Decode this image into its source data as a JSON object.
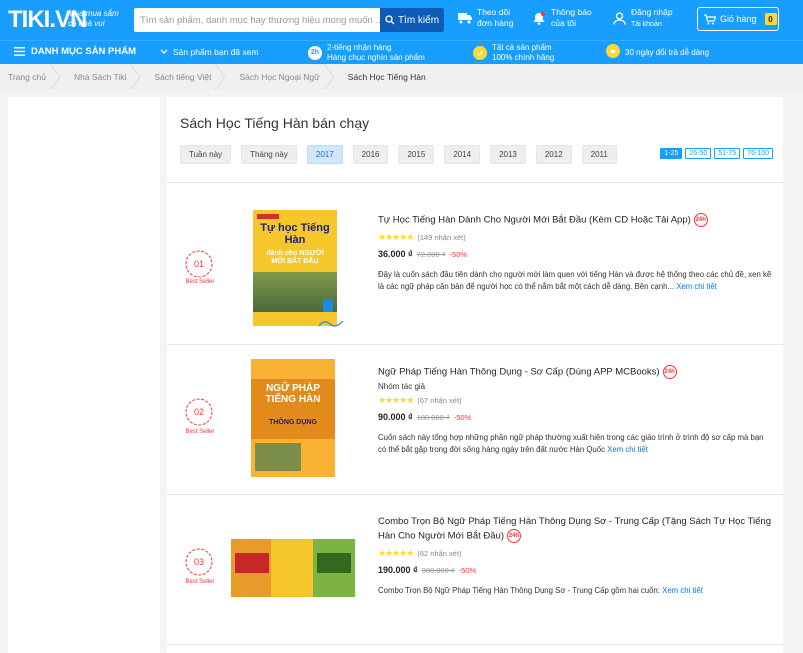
{
  "header": {
    "logo": "TIKI.VN",
    "tagline": "Mua mua sắm cả nhà vui",
    "search_placeholder": "Tìm sản phẩm, danh mục hay thương hiệu mong muốn ...",
    "search_button": "Tìm kiếm",
    "track_line1": "Theo dõi",
    "track_line2": "đơn hàng",
    "notify_line1": "Thông báo",
    "notify_line2": "của tôi",
    "login_line1": "Đăng nhập",
    "login_line2": "Tài khoản",
    "cart_label": "Giỏ hàng",
    "cart_count": "0"
  },
  "nav": {
    "menu_label": "DANH MỤC SẢN PHẨM",
    "viewed_label": "Sản phẩm bạn đã xem",
    "promo1_icon": "2h",
    "promo1_line1": "2-tiếng nhận hàng",
    "promo1_line2": "Hàng chục nghìn sản phẩm",
    "promo2_line1": "Tất cả sản phẩm",
    "promo2_line2": "100% chính hãng",
    "promo3_label": "30 ngày đổi trả dễ dàng"
  },
  "breadcrumb": [
    "Trang chủ",
    "Nhà Sách Tiki",
    "Sách tiếng Việt",
    "Sách Học Ngoại Ngữ",
    "Sách Học Tiếng Hàn"
  ],
  "page": {
    "title": "Sách Học Tiếng Hàn bán chạy",
    "tabs": [
      "Tuần này",
      "Tháng này",
      "2017",
      "2016",
      "2015",
      "2014",
      "2013",
      "2012",
      "2011"
    ],
    "pages": [
      "1-25",
      "26-50",
      "51-75",
      "76-100"
    ]
  },
  "products": [
    {
      "rank": "01",
      "rank_label": "Best Seller",
      "title": "Tự Học Tiếng Hàn Dành Cho Người Mới Bắt Đầu (Kèm CD Hoặc Tải App)",
      "badge": "24h",
      "stars": "★★★★★",
      "reviews": "(149 nhận xét)",
      "price": "36.000 ₫",
      "old_price": "72.000 ₫",
      "discount": "-50%",
      "desc": "Đây là cuốn sách đầu tiên dành cho người mới làm quen với tiếng Hàn và được hệ thống theo các chủ đề, xen kẽ là các ngữ pháp căn bản để người học có thể nắm bắt một cách dễ dàng. Bên cạnh...",
      "more": "Xem chi tiết",
      "cover_title": "Tự học Tiếng Hàn",
      "cover_sub": "dành cho NGƯỜI MỚI BẮT ĐẦU"
    },
    {
      "rank": "02",
      "rank_label": "Best Seller",
      "title": "Ngữ Pháp Tiếng Hàn Thông Dụng - Sơ Cấp (Dùng APP MCBooks)",
      "badge": "24h",
      "author": "Nhóm tác giả",
      "stars": "★★★★★",
      "reviews": "(67 nhận xét)",
      "price": "90.000 ₫",
      "old_price": "180.000 ₫",
      "discount": "-50%",
      "desc": "Cuốn sách này tổng hợp những phần ngữ pháp thường xuất hiện trong các giáo trình ở trình độ sơ cấp mà bạn có thể bắt gặp trong đời sống hàng ngày trên đất nước Hàn Quốc",
      "more": "Xem chi tiết",
      "cover_title": "NGỮ PHÁP TIẾNG HÀN",
      "cover_sub": "THÔNG DỤNG"
    },
    {
      "rank": "03",
      "rank_label": "Best Seller",
      "title": "Combo Trọn Bộ Ngữ Pháp Tiếng Hàn Thông Dụng Sơ - Trung Cấp (Tặng Sách Tự Học Tiếng Hàn Cho Người Mới Bắt Đầu)",
      "badge": "24h",
      "stars": "★★★★★",
      "reviews": "(62 nhận xét)",
      "price": "190.000 ₫",
      "old_price": "380.000 ₫",
      "discount": "-50%",
      "desc": "Combo Trọn Bộ Ngữ Pháp Tiếng Hàn Thông Dụng Sơ - Trung Cấp gồm hai cuốn:",
      "more": "Xem chi tiết"
    }
  ],
  "colors": {
    "brand": "#189eff",
    "accent_red": "#ff3333",
    "link": "#0b74e5"
  }
}
